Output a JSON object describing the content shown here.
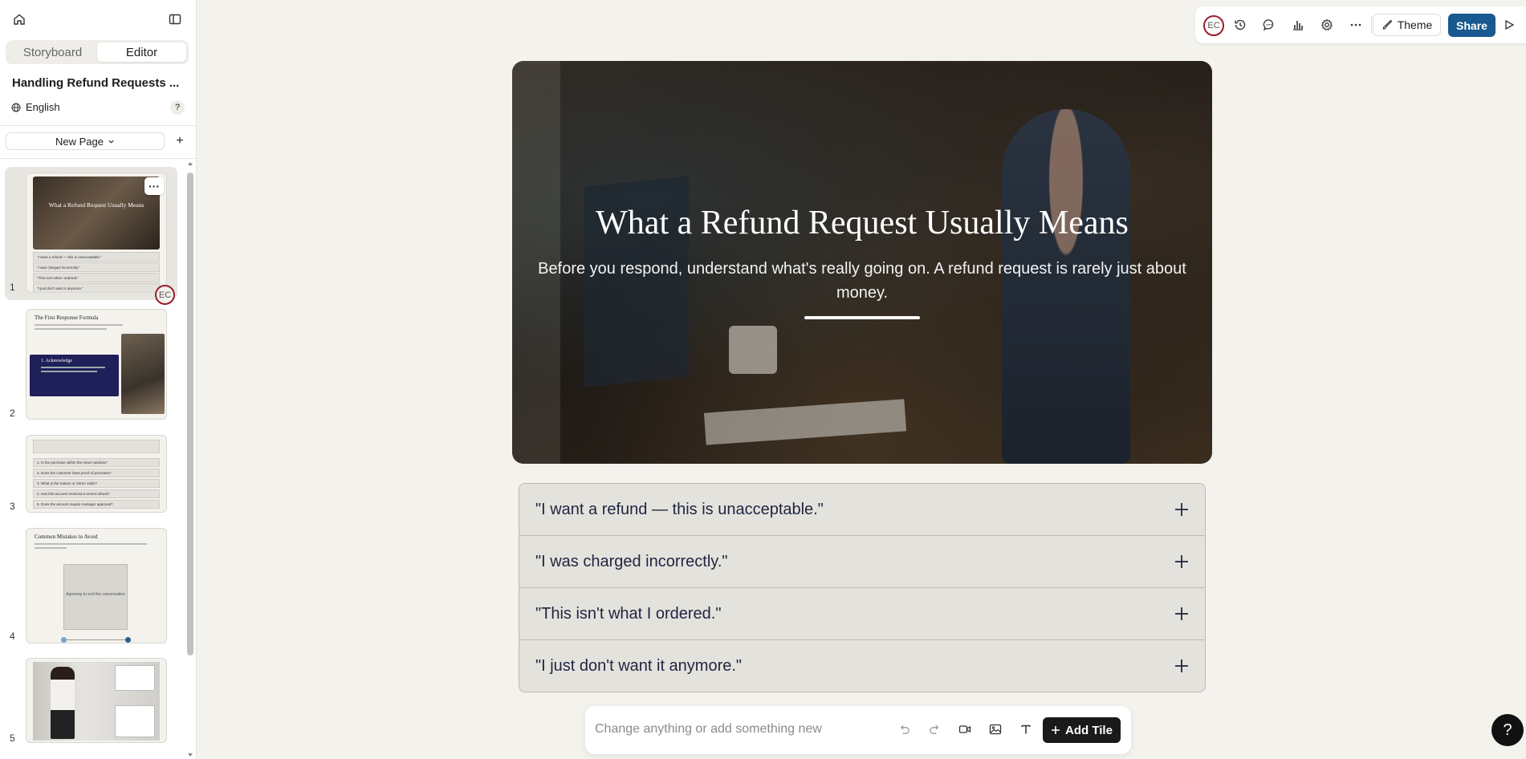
{
  "sidebar": {
    "tabs": [
      {
        "label": "Storyboard"
      },
      {
        "label": "Editor"
      }
    ],
    "active_tab": "Editor",
    "doc_title": "Handling Refund Requests ...",
    "language": "English",
    "help": "?",
    "new_page_label": "New Page",
    "add_page": "+",
    "thumbnails": [
      {
        "num": "1",
        "title": "What a Refund Request Usually Means",
        "rows": [
          "\"I want a refund — this is unacceptable.\"",
          "\"I was charged incorrectly.\"",
          "\"This isn't what I ordered.\"",
          "\"I just don't want it anymore.\""
        ],
        "avatar": "EC"
      },
      {
        "num": "2",
        "title": "The First Response Formula",
        "callout": "1. Acknowledge"
      },
      {
        "num": "3",
        "rows": [
          "1. Is the purchase within the return window?",
          "2. Does the customer have proof of purchase?",
          "3. What is the reason or return order?",
          "4. Has this account received a recent refund?",
          "5. Does the amount require manager approval?"
        ]
      },
      {
        "num": "4",
        "title": "Common Mistakes to Avoid",
        "card": "Agreeing to end the conversation"
      },
      {
        "num": "5"
      }
    ]
  },
  "toolbar": {
    "avatar": "EC",
    "theme_label": "Theme",
    "share_label": "Share"
  },
  "slide": {
    "title": "What a Refund Request Usually Means",
    "subtitle": "Before you respond, understand what's really going on. A refund request is rarely just about money.",
    "accordion": [
      {
        "label": "\"I want a refund — this is unacceptable.\""
      },
      {
        "label": "\"I was charged incorrectly.\""
      },
      {
        "label": "\"This isn't what I ordered.\""
      },
      {
        "label": "\"I just don't want it anymore.\""
      }
    ]
  },
  "composer": {
    "placeholder": "Change anything or add something new",
    "add_tile_label": "Add Tile"
  },
  "help_fab": "?",
  "colors": {
    "background": "#f4f2ed",
    "share": "#18598f",
    "avatar_ring": "#9b1c2e",
    "accordion_text": "#1f2540"
  }
}
